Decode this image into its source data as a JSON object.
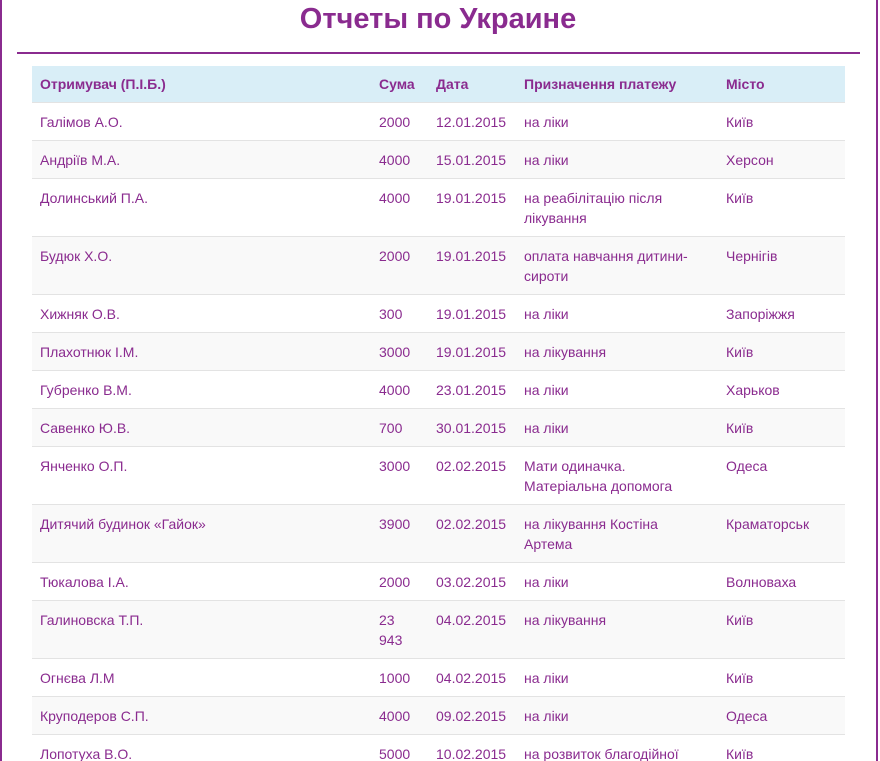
{
  "page": {
    "title": "Отчеты по Украине"
  },
  "table": {
    "headers": [
      "Отримувач (П.І.Б.)",
      "Сума",
      "Дата",
      "Призначення платежу",
      "Місто"
    ],
    "rows": [
      [
        "Галімов А.О.",
        "2000",
        "12.01.2015",
        "на ліки",
        "Київ"
      ],
      [
        "Андріїв М.А.",
        "4000",
        "15.01.2015",
        "на ліки",
        "Херсон"
      ],
      [
        "Долинський П.А.",
        "4000",
        "19.01.2015",
        "на реабілітацію після лікування",
        "Київ"
      ],
      [
        "Будюк Х.О.",
        "2000",
        "19.01.2015",
        "оплата навчання дитини-сироти",
        "Чернігів"
      ],
      [
        "Хижняк О.В.",
        "300",
        "19.01.2015",
        "на ліки",
        "Запоріжжя"
      ],
      [
        "Плахотнюк І.М.",
        "3000",
        "19.01.2015",
        "на лікування",
        "Київ"
      ],
      [
        "Губренко В.М.",
        "4000",
        "23.01.2015",
        "на ліки",
        "Харьков"
      ],
      [
        "Савенко Ю.В.",
        "700",
        "30.01.2015",
        "на ліки",
        "Київ"
      ],
      [
        "Янченко О.П.",
        "3000",
        "02.02.2015",
        "Мати одиначка. Матеріальна допомога",
        "Одеса"
      ],
      [
        "Дитячий будинок «Гайок»",
        "3900",
        "02.02.2015",
        "на лікування Костіна Артема",
        "Краматорськ"
      ],
      [
        "Тюкалова І.А.",
        "2000",
        "03.02.2015",
        "на ліки",
        "Волноваха"
      ],
      [
        "Галиновска Т.П.",
        "23 943",
        "04.02.2015",
        "на лікування",
        "Київ"
      ],
      [
        "Огнєва Л.М",
        "1000",
        "04.02.2015",
        "на ліки",
        "Київ"
      ],
      [
        "Круподеров С.П.",
        "4000",
        "09.02.2015",
        "на ліки",
        "Одеса"
      ],
      [
        "Лопотуха В.О.",
        "5000",
        "10.02.2015",
        "на розвиток благодійної організації «Територія",
        "Київ"
      ]
    ]
  }
}
